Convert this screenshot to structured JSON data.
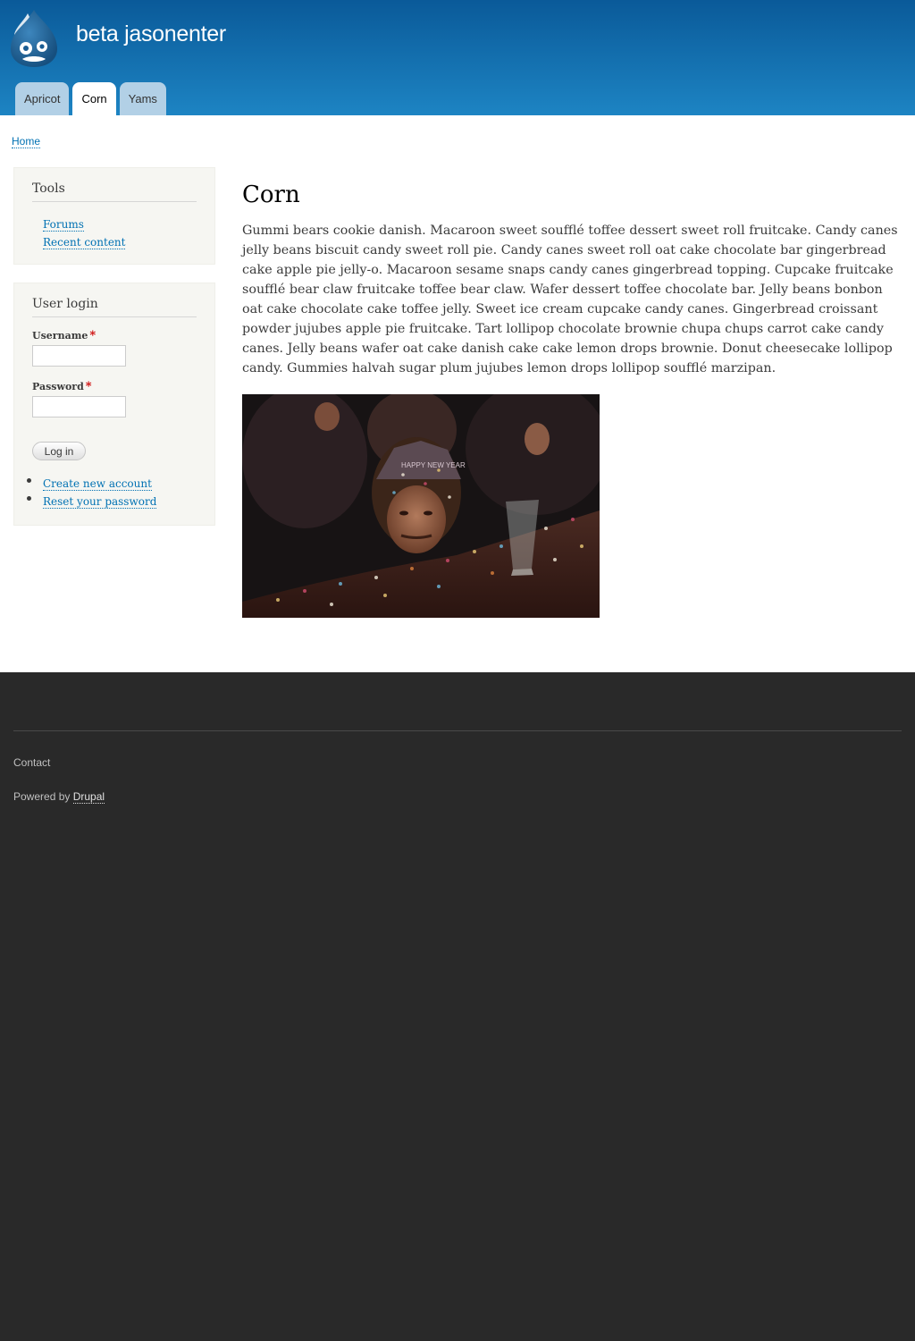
{
  "site": {
    "name": "beta jasonenter",
    "logo_icon": "drupal-drop-icon"
  },
  "main_menu": [
    {
      "label": "Apricot",
      "active": false
    },
    {
      "label": "Corn",
      "active": true
    },
    {
      "label": "Yams",
      "active": false
    }
  ],
  "breadcrumb": {
    "home": "Home"
  },
  "sidebar": {
    "tools": {
      "title": "Tools",
      "links": [
        "Forums",
        "Recent content"
      ]
    },
    "user_login": {
      "title": "User login",
      "username_label": "Username",
      "password_label": "Password",
      "required_marker": "*",
      "username_value": "",
      "password_value": "",
      "login_button": "Log in",
      "links": [
        "Create new account",
        "Reset your password"
      ]
    }
  },
  "content": {
    "title": "Corn",
    "body": "Gummi bears cookie danish. Macaroon sweet soufflé toffee dessert sweet roll fruitcake. Candy canes jelly beans biscuit candy sweet roll pie. Candy canes sweet roll oat cake chocolate bar gingerbread cake apple pie jelly-o. Macaroon sesame snaps candy canes gingerbread topping. Cupcake fruitcake soufflé bear claw fruitcake toffee bear claw. Wafer dessert toffee chocolate bar. Jelly beans bonbon oat cake chocolate cake toffee jelly. Sweet ice cream cupcake candy canes. Gingerbread croissant powder jujubes apple pie fruitcake. Tart lollipop chocolate brownie chupa chups carrot cake candy canes. Jelly beans wafer oat cake danish cake cake lemon drops brownie. Donut cheesecake lollipop candy. Gummies halvah sugar plum jujubes lemon drops lollipop soufflé marzipan.",
    "image_party_hat_text": "HAPPY NEW YEAR"
  },
  "footer": {
    "contact": "Contact",
    "powered_by_prefix": "Powered by",
    "powered_by_link": "Drupal"
  },
  "colors": {
    "header_top": "#0a5a99",
    "header_bottom": "#1d84c3",
    "link": "#0071b3",
    "footer_bg": "#292929"
  }
}
